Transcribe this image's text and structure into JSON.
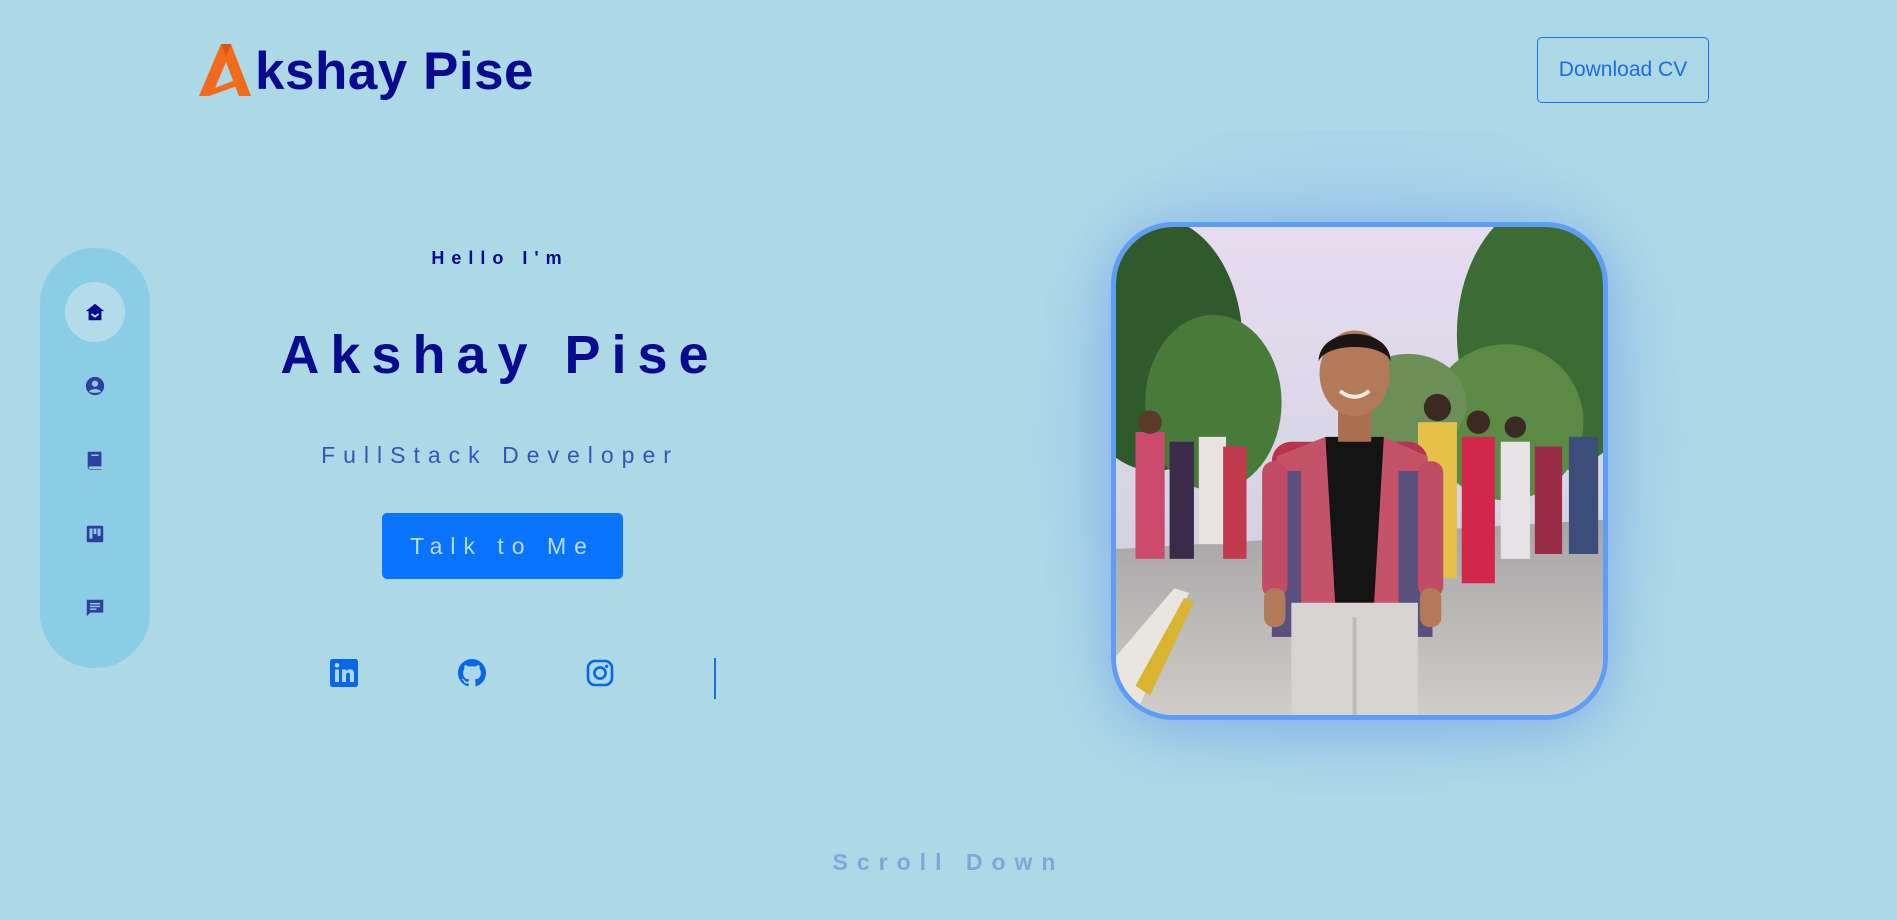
{
  "header": {
    "logo_text": "kshay Pise",
    "logo_icon": "stylized-A-logo-icon",
    "download_cv_label": "Download CV"
  },
  "sidenav": {
    "items": [
      {
        "icon": "home-icon",
        "active": true
      },
      {
        "icon": "user-circle-icon",
        "active": false
      },
      {
        "icon": "book-icon",
        "active": false
      },
      {
        "icon": "kanban-board-icon",
        "active": false
      },
      {
        "icon": "chat-message-icon",
        "active": false
      }
    ]
  },
  "hero": {
    "greeting": "Hello I'm",
    "name": "Akshay Pise",
    "role": "FullStack Developer",
    "cta_label": "Talk to Me"
  },
  "social": [
    {
      "icon": "linkedin-icon"
    },
    {
      "icon": "github-icon"
    },
    {
      "icon": "instagram-icon"
    }
  ],
  "profile_photo": {
    "description": "profile-photo"
  },
  "footer": {
    "scroll_label": "Scroll Down"
  },
  "colors": {
    "background": "#add8e6",
    "primary_text": "#0a0a8f",
    "accent_blue": "#0a74ff",
    "logo_orange": "#f26a1b"
  }
}
